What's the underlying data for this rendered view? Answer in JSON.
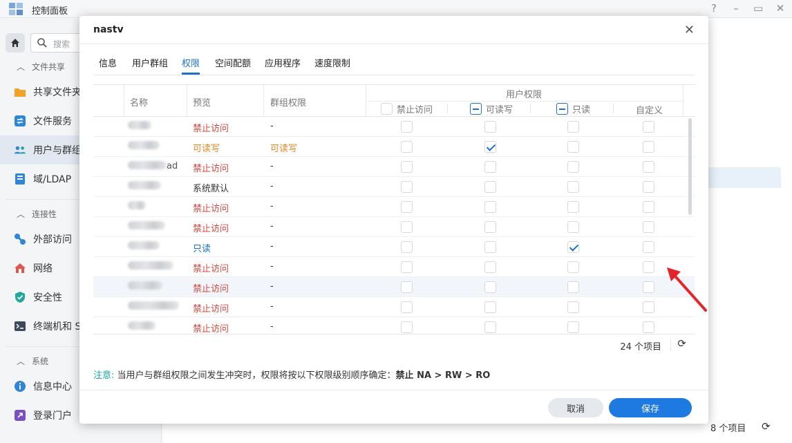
{
  "window": {
    "title": "控制面板"
  },
  "sidebar": {
    "search_placeholder": "搜索",
    "sections": [
      {
        "label": "文件共享"
      },
      {
        "label": "连接性"
      },
      {
        "label": "系统"
      }
    ],
    "items": [
      {
        "label": "共享文件夹"
      },
      {
        "label": "文件服务"
      },
      {
        "label": "用户与群组"
      },
      {
        "label": "域/LDAP"
      },
      {
        "label": "外部访问"
      },
      {
        "label": "网络"
      },
      {
        "label": "安全性"
      },
      {
        "label": "终端机和 S"
      },
      {
        "label": "信息中心"
      },
      {
        "label": "登录门户"
      }
    ]
  },
  "background": {
    "item_count": "8 个项目"
  },
  "dialog": {
    "title": "nastv",
    "tabs": [
      "信息",
      "用户群组",
      "权限",
      "空间配额",
      "应用程序",
      "速度限制"
    ],
    "active_tab": "权限",
    "columns": {
      "name": "名称",
      "preview": "预览",
      "group_perm": "群组权限",
      "user_perm": "用户权限",
      "deny": "禁止访问",
      "rw": "可读写",
      "ro": "只读",
      "custom": "自定义"
    },
    "rows": [
      {
        "name_suffix": "",
        "preview": "禁止访问",
        "group": "-",
        "rw": false,
        "ro": false
      },
      {
        "name_suffix": "",
        "preview": "可读写",
        "group": "可读写",
        "rw": true,
        "ro": false
      },
      {
        "name_suffix": "ad",
        "preview": "禁止访问",
        "group": "-",
        "rw": false,
        "ro": false
      },
      {
        "name_suffix": "",
        "preview": "系统默认",
        "group": "-",
        "rw": false,
        "ro": false
      },
      {
        "name_suffix": "",
        "preview": "禁止访问",
        "group": "-",
        "rw": false,
        "ro": false
      },
      {
        "name_suffix": "",
        "preview": "禁止访问",
        "group": "-",
        "rw": false,
        "ro": false
      },
      {
        "name_suffix": "",
        "preview": "只读",
        "group": "-",
        "rw": false,
        "ro": true
      },
      {
        "name_suffix": "",
        "preview": "禁止访问",
        "group": "-",
        "rw": false,
        "ro": false
      },
      {
        "name_suffix": "",
        "preview": "禁止访问",
        "group": "-",
        "rw": false,
        "ro": false
      },
      {
        "name_suffix": "",
        "preview": "禁止访问",
        "group": "-",
        "rw": false,
        "ro": false
      },
      {
        "name_suffix": "",
        "preview": "禁止访问",
        "group": "-",
        "rw": false,
        "ro": false
      }
    ],
    "item_count": "24 个项目",
    "note_label": "注意:",
    "note_text": "当用户与群组权限之间发生冲突时，权限将按以下权限级别顺序确定：",
    "note_strong": "禁止 NA > RW > RO",
    "cancel": "取消",
    "save": "保存"
  },
  "colors": {
    "accent": "#1e71c7",
    "deny": "#d9453b",
    "rw": "#e8871e",
    "annotation_arrow": "#e3262b"
  }
}
